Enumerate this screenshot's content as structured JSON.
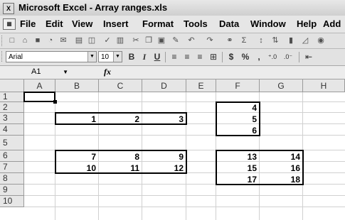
{
  "window": {
    "app_icon": "excel-icon",
    "title": "Microsoft Excel - Array ranges.xls"
  },
  "menu": [
    "File",
    "Edit",
    "View",
    "Insert",
    "Format",
    "Tools",
    "Data",
    "Window",
    "Help",
    "Add"
  ],
  "format_bar": {
    "font_name": "Arial",
    "font_size": "10",
    "bold": "B",
    "italic": "I",
    "underline": "U",
    "currency": "$",
    "percent": "%",
    "comma": ","
  },
  "formula_bar": {
    "name_box": "A1",
    "fx_label": "fx",
    "formula": ""
  },
  "sheet": {
    "columns": [
      "A",
      "B",
      "C",
      "D",
      "E",
      "F",
      "G",
      "H"
    ],
    "rows": [
      "1",
      "2",
      "3",
      "4",
      "5",
      "6",
      "7",
      "8",
      "9",
      "10"
    ],
    "cells": {
      "F2": "4",
      "F3": "5",
      "F4": "6",
      "B3": "1",
      "C3": "2",
      "D3": "3",
      "B6": "7",
      "C6": "8",
      "D6": "9",
      "B7": "10",
      "C7": "11",
      "D7": "12",
      "F6": "13",
      "G6": "14",
      "F7": "15",
      "G7": "16",
      "F8": "17",
      "G8": "18"
    },
    "active_cell": "A1"
  }
}
